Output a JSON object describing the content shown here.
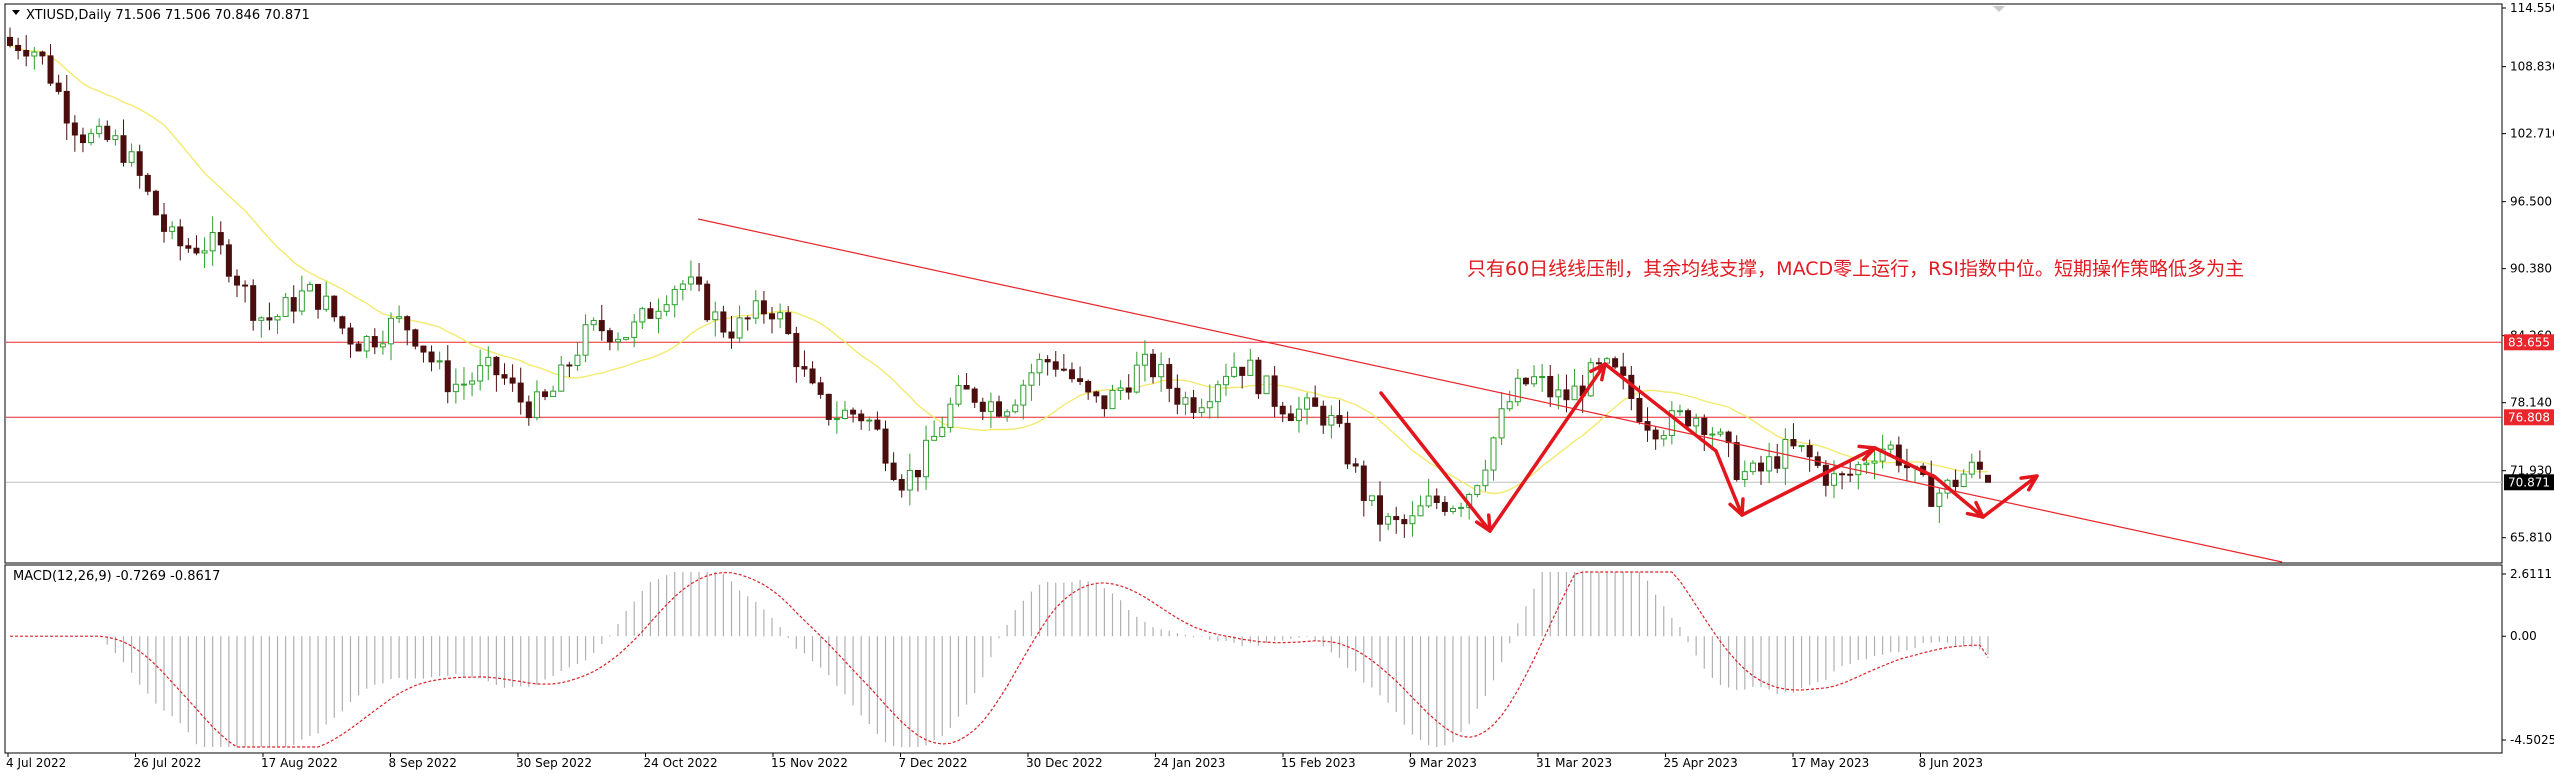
{
  "header": {
    "symbol_line": "XTIUSD,Daily  71.506 71.506 70.846 70.871"
  },
  "annotation": {
    "text": "只有60日线线压制，其余均线支撑，MACD零上运行，RSI指数中位。短期操作策略低多为主"
  },
  "price_axis": {
    "ticks": [
      {
        "value": 114.55,
        "label": "114.550"
      },
      {
        "value": 108.83,
        "label": "108.830"
      },
      {
        "value": 102.71,
        "label": "102.710"
      },
      {
        "value": 96.5,
        "label": "96.500"
      },
      {
        "value": 90.38,
        "label": "90.380"
      },
      {
        "value": 84.26,
        "label": "84.260"
      },
      {
        "value": 78.14,
        "label": "78.140"
      },
      {
        "value": 71.93,
        "label": "71.930"
      },
      {
        "value": 65.81,
        "label": "65.810"
      }
    ],
    "markers": [
      {
        "value": 83.655,
        "label": "83.655",
        "color": "#e8262b"
      },
      {
        "value": 76.808,
        "label": "76.808",
        "color": "#e8262b"
      },
      {
        "value": 70.871,
        "label": "70.871",
        "color": "#000000"
      }
    ]
  },
  "macd": {
    "label": "MACD(12,26,9) -0.7269 -0.8617",
    "ticks": [
      {
        "value": 2.6111,
        "label": "2.6111"
      },
      {
        "value": 0.0,
        "label": "0.00"
      },
      {
        "value": -4.5025,
        "label": "-4.5025"
      }
    ]
  },
  "time_axis": {
    "labels": [
      "4 Jul 2022",
      "26 Jul 2022",
      "17 Aug 2022",
      "8 Sep 2022",
      "30 Sep 2022",
      "24 Oct 2022",
      "15 Nov 2022",
      "7 Dec 2022",
      "30 Dec 2022",
      "24 Jan 2023",
      "15 Feb 2023",
      "9 Mar 2023",
      "31 Mar 2023",
      "25 Apr 2023",
      "17 May 2023",
      "8 Jun 2023"
    ]
  },
  "colors": {
    "bull": "#2e9e2e",
    "bear": "#4a0e0e",
    "ma": "#f3ea6e",
    "resistance": "#e8262b",
    "trend": "#e8262b",
    "arrows": "#e3161d",
    "macd_signal": "#d9232a",
    "macd_hist": "#b0b0b0"
  },
  "chart_data": [
    {
      "type": "candlestick",
      "title": "XTIUSD,Daily",
      "x_start": "4 Jul 2022",
      "x_end": "8 Jun 2023",
      "ylim": [
        63.5,
        114.55
      ],
      "current_price": 70.871,
      "last_bar": {
        "open": 71.506,
        "high": 71.506,
        "low": 70.846,
        "close": 70.871
      },
      "horizontal_levels": [
        83.655,
        76.808
      ],
      "anchors": [
        [
          "4 Jul 2022",
          111.0
        ],
        [
          "26 Jul 2022",
          97.5
        ],
        [
          "17 Aug 2022",
          88.5
        ],
        [
          "8 Sep 2022",
          83.0
        ],
        [
          "30 Sep 2022",
          79.5
        ],
        [
          "24 Oct 2022",
          86.5
        ],
        [
          "15 Nov 2022",
          85.5
        ],
        [
          "7 Dec 2022",
          72.5
        ],
        [
          "30 Dec 2022",
          80.0
        ],
        [
          "24 Jan 2023",
          81.0
        ],
        [
          "15 Feb 2023",
          78.5
        ],
        [
          "9 Mar 2023",
          66.8
        ],
        [
          "31 Mar 2023",
          79.5
        ],
        [
          "25 Apr 2023",
          77.5
        ],
        [
          "17 May 2023",
          72.5
        ],
        [
          "8 Jun 2023",
          70.9
        ]
      ],
      "moving_average": "yellow line"
    },
    {
      "type": "macd",
      "title": "MACD(12,26,9)",
      "main": -0.7269,
      "signal": -0.8617,
      "ylim": [
        -4.5025,
        2.6111
      ]
    }
  ]
}
